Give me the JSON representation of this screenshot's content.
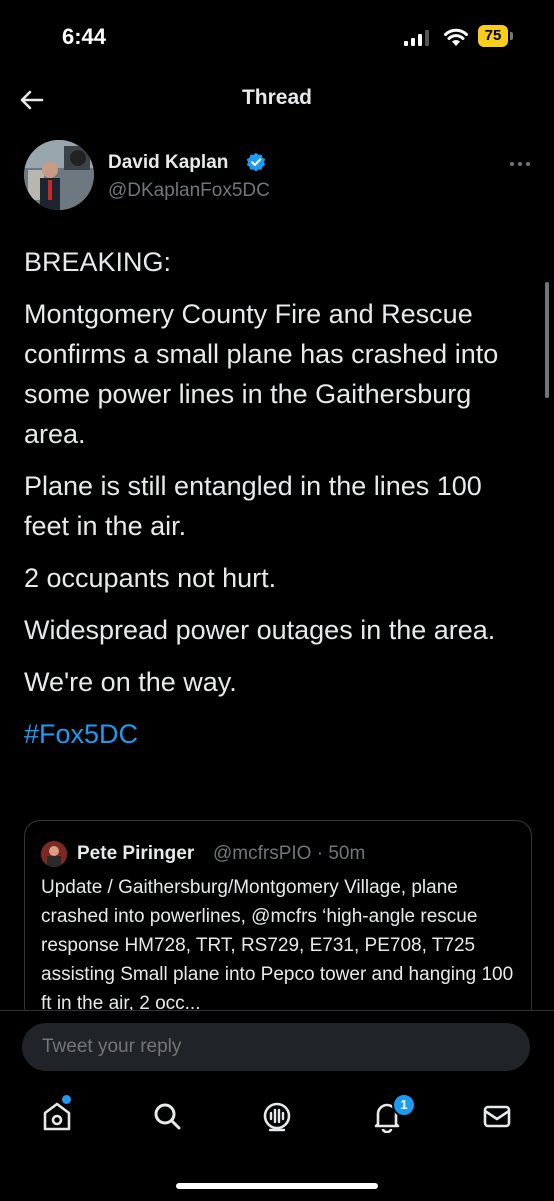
{
  "status_bar": {
    "time": "6:44",
    "battery_level": "75",
    "battery_color": "#f7cd1b"
  },
  "nav": {
    "title": "Thread",
    "back_icon": "arrow-left-icon"
  },
  "tweet": {
    "author_name": "David Kaplan",
    "author_handle": "@DKaplanFox5DC",
    "verified": true,
    "paragraphs": [
      "BREAKING:",
      "Montgomery County Fire and Rescue confirms a small plane has crashed into some power lines in the Gaithersburg area.",
      "Plane is still entangled in the lines 100 feet in the air.",
      "2 occupants not hurt.",
      "Widespread power outages in the area.",
      "We're on the way."
    ],
    "hashtag": "#Fox5DC",
    "quote": {
      "author_name": "Pete Piringer",
      "author_meta": "@mcfrsPIO · 50m",
      "text": "Update / Gaithersburg/Montgomery Village, plane crashed into powerlines, @mcfrs ‘high-angle rescue response HM728, TRT, RS729, E731, PE708, T725 assisting Small plane into Pepco tower and hanging 100 ft in the air, 2 occ..."
    }
  },
  "reply": {
    "placeholder": "Tweet your reply"
  },
  "tabs": {
    "home_icon": "home-icon",
    "search_icon": "search-icon",
    "spaces_icon": "spaces-icon",
    "notifications_icon": "bell-icon",
    "notifications_count": "1",
    "messages_icon": "mail-icon"
  },
  "colors": {
    "accent": "#1d9bf0",
    "background": "#000000",
    "text": "#e7e9ea",
    "muted": "#71767b"
  }
}
